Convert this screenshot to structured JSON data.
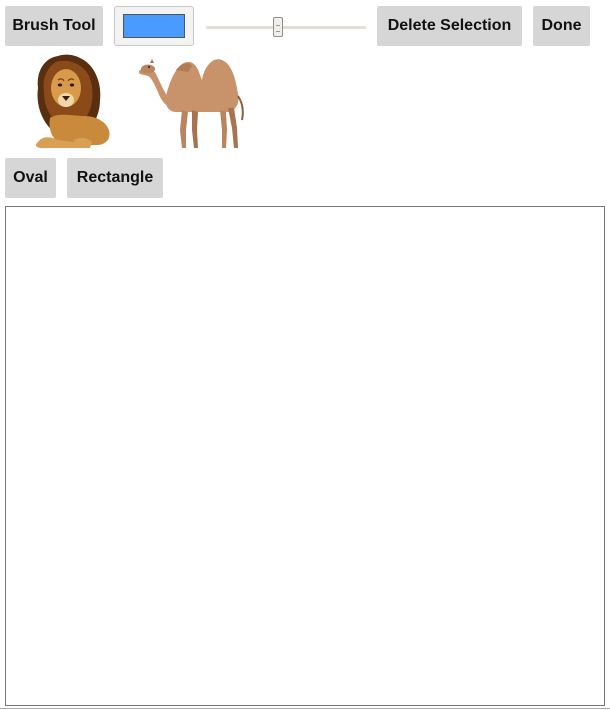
{
  "toolbar": {
    "brush_label": "Brush Tool",
    "delete_label": "Delete Selection",
    "done_label": "Done",
    "color_value": "#4a9bff",
    "brush_size_fraction": 0.45
  },
  "stickers": [
    {
      "name": "lion",
      "icon": "lion-sticker"
    },
    {
      "name": "camel",
      "icon": "camel-sticker"
    }
  ],
  "shapes": {
    "oval_label": "Oval",
    "rectangle_label": "Rectangle"
  },
  "canvas": {
    "background": "#ffffff"
  }
}
